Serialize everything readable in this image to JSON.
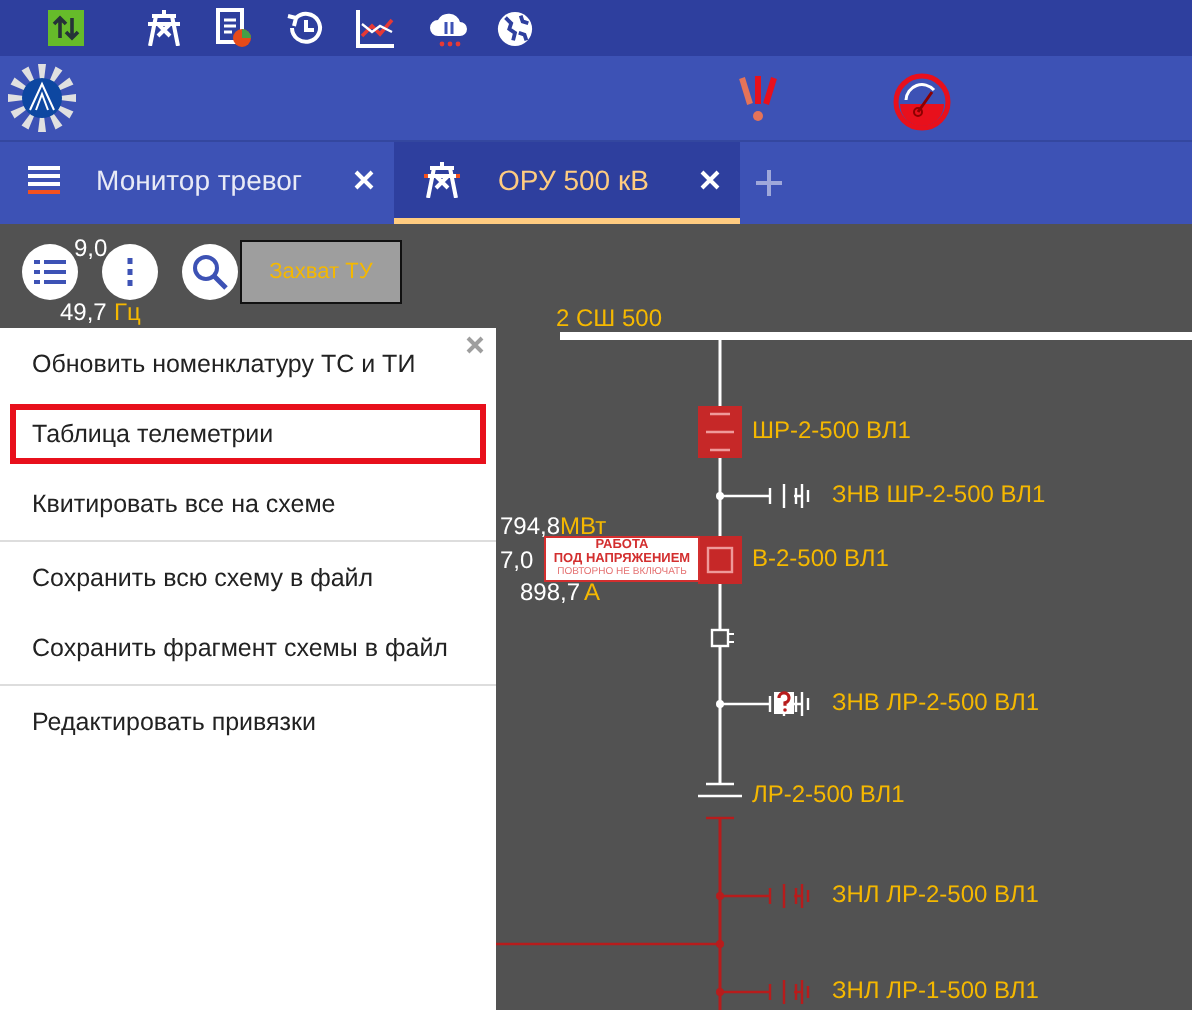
{
  "tabs": [
    {
      "label": "Монитор тревог",
      "selected": false
    },
    {
      "label": "ОРУ 500 кВ",
      "selected": true
    }
  ],
  "schematic": {
    "capture_button": "Захват ТУ",
    "bus_label": "2 СШ 500",
    "frequency_readings": [
      {
        "value": "9,0"
      },
      {
        "value": "49,7",
        "unit": "Гц"
      }
    ],
    "feeder_readings": [
      {
        "value": "794,8",
        "unit": "МВт"
      },
      {
        "value": "7,0"
      },
      {
        "value": "898,7",
        "unit": "А"
      }
    ],
    "elements": [
      {
        "kind": "disconnector",
        "label": "ШР-2-500 ВЛ1",
        "grounded": false
      },
      {
        "kind": "ground_switch",
        "label": "ЗНВ ШР-2-500 ВЛ1",
        "grounded": false,
        "state_unknown": false
      },
      {
        "kind": "breaker",
        "label": "В-2-500 ВЛ1",
        "grounded": false,
        "tag_lines": [
          "РАБОТА",
          "ПОД НАПРЯЖЕНИЕМ",
          "ПОВТОРНО НЕ ВКЛЮЧАТЬ"
        ]
      },
      {
        "kind": "connector",
        "grounded": false
      },
      {
        "kind": "ground_switch",
        "label": "ЗНВ ЛР-2-500 ВЛ1",
        "grounded": false,
        "state_unknown": true
      },
      {
        "kind": "line_disconnector",
        "label": "ЛР-2-500 ВЛ1",
        "grounded": false
      },
      {
        "kind": "ground_switch",
        "label": "ЗНЛ ЛР-2-500 ВЛ1",
        "grounded": true,
        "state_unknown": false
      },
      {
        "kind": "branch",
        "grounded": true
      },
      {
        "kind": "ground_switch",
        "label": "ЗНЛ ЛР-1-500 ВЛ1",
        "grounded": true,
        "state_unknown": false
      }
    ]
  },
  "menu": {
    "groups": [
      [
        {
          "label": "Обновить номенклатуру ТС и ТИ",
          "selected": false
        },
        {
          "label": "Таблица телеметрии",
          "selected": true
        },
        {
          "label": "Квитировать все на схеме",
          "selected": false
        }
      ],
      [
        {
          "label": "Сохранить всю схему в файл",
          "selected": false
        },
        {
          "label": "Сохранить фрагмент схемы в файл",
          "selected": false
        }
      ],
      [
        {
          "label": "Редактировать привязки",
          "selected": false
        }
      ]
    ]
  }
}
